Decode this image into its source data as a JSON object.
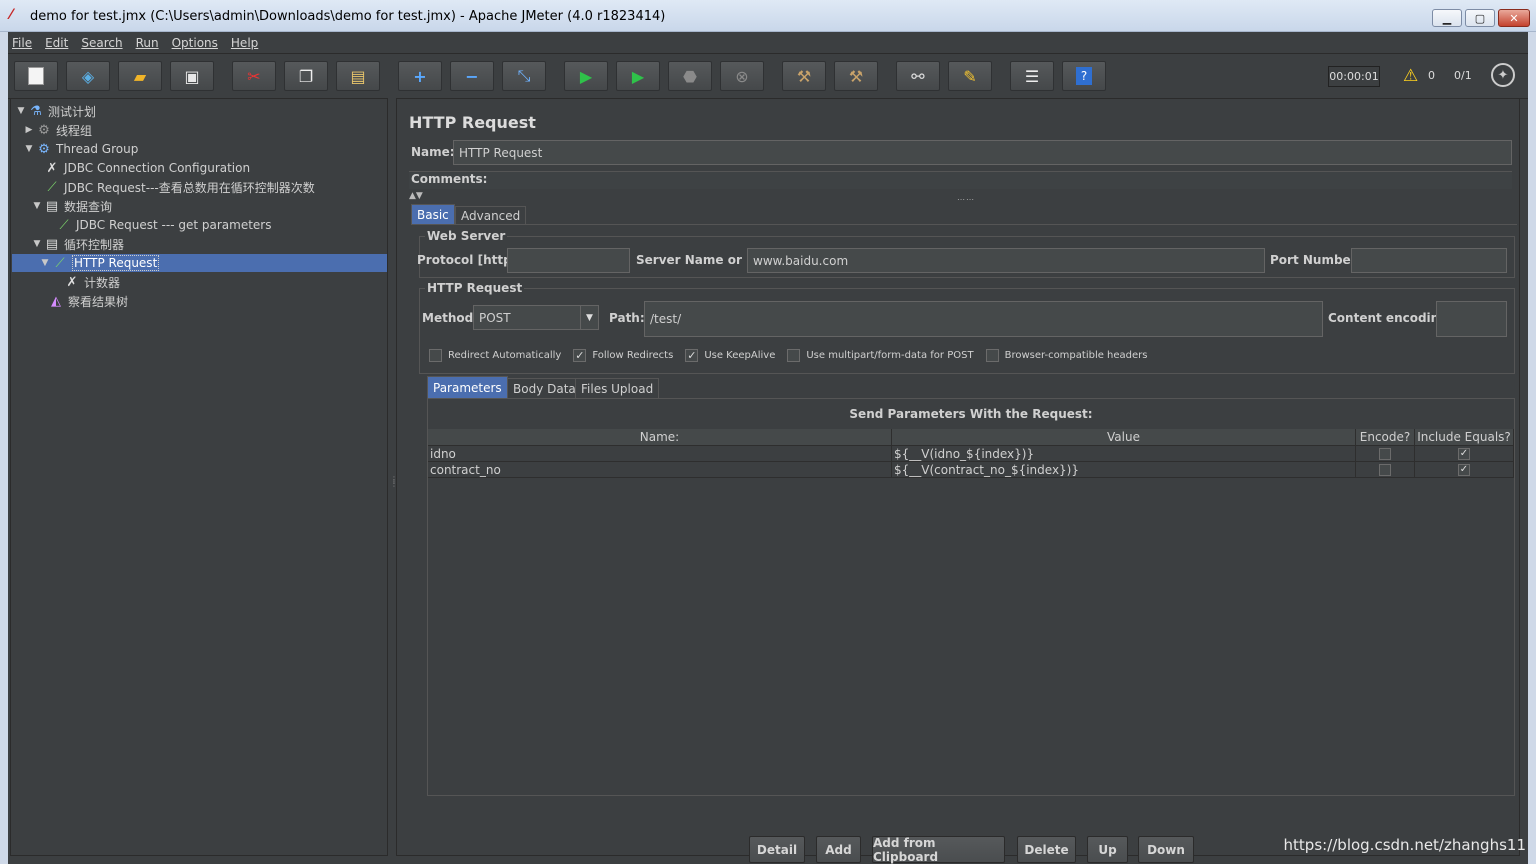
{
  "window": {
    "title": "demo for test.jmx (C:\\Users\\admin\\Downloads\\demo for test.jmx) - Apache JMeter (4.0 r1823414)",
    "buttons": {
      "minimize": "▁",
      "maximize": "▢",
      "close": "✕"
    }
  },
  "menu": [
    "File",
    "Edit",
    "Search",
    "Run",
    "Options",
    "Help"
  ],
  "toolbar": {
    "icons": [
      "new-icon",
      "templates-icon",
      "open-icon",
      "save-icon",
      "cut-icon",
      "copy-icon",
      "paste-icon",
      "expand-icon",
      "collapse-icon",
      "toggle-icon",
      "start-icon",
      "start-no-pause-icon",
      "stop-icon",
      "shutdown-icon",
      "clear-icon",
      "clear-all-icon",
      "search-icon",
      "reset-search-icon",
      "function-helper-icon",
      "help-icon"
    ],
    "timer": "00:00:01",
    "warning_count": "0",
    "threads": "0/1"
  },
  "tree": {
    "items": [
      {
        "label": "测试计划",
        "icon": "flask-icon"
      },
      {
        "label": "线程组",
        "icon": "gear-icon"
      },
      {
        "label": "Thread Group",
        "icon": "gear-icon"
      },
      {
        "label": "JDBC Connection Configuration",
        "icon": "wrench-icon"
      },
      {
        "label": "JDBC Request---查看总数用在循环控制器次数",
        "icon": "pipette-icon"
      },
      {
        "label": "数据查询",
        "icon": "controller-icon"
      },
      {
        "label": "JDBC Request --- get parameters",
        "icon": "pipette-icon"
      },
      {
        "label": "循环控制器",
        "icon": "controller-icon"
      },
      {
        "label": "HTTP Request",
        "icon": "pipette-icon"
      },
      {
        "label": "计数器",
        "icon": "wrench-icon"
      },
      {
        "label": "察看结果树",
        "icon": "chart-icon"
      }
    ]
  },
  "panel": {
    "title": "HTTP Request",
    "name_label": "Name:",
    "name_value": "HTTP Request",
    "comments_label": "Comments:",
    "tabs": [
      "Basic",
      "Advanced"
    ],
    "web_server": {
      "title": "Web Server",
      "protocol_label": "Protocol [http]:",
      "protocol_value": "",
      "server_label": "Server Name or IP:",
      "server_value": "www.baidu.com",
      "port_label": "Port Number:",
      "port_value": ""
    },
    "http_request": {
      "title": "HTTP Request",
      "method_label": "Method:",
      "method_value": "POST",
      "path_label": "Path:",
      "path_value": "/test/",
      "encoding_label": "Content encoding:",
      "encoding_value": ""
    },
    "checkboxes": [
      {
        "label": "Redirect Automatically",
        "checked": ""
      },
      {
        "label": "Follow Redirects",
        "checked": "✓"
      },
      {
        "label": "Use KeepAlive",
        "checked": "✓"
      },
      {
        "label": "Use multipart/form-data for POST",
        "checked": ""
      },
      {
        "label": "Browser-compatible headers",
        "checked": ""
      }
    ],
    "sub_tabs": [
      "Parameters",
      "Body Data",
      "Files Upload"
    ],
    "params_heading": "Send Parameters With the Request:",
    "columns": [
      "Name:",
      "Value",
      "Encode?",
      "Include Equals?"
    ],
    "rows": [
      {
        "name": "idno",
        "value": "${__V(idno_${index})}",
        "encode": "",
        "include": "✓"
      },
      {
        "name": "contract_no",
        "value": "${__V(contract_no_${index})}",
        "encode": "",
        "include": "✓"
      }
    ],
    "buttons": [
      "Detail",
      "Add",
      "Add from Clipboard",
      "Delete",
      "Up",
      "Down"
    ]
  },
  "watermark": "https://blog.csdn.net/zhanghs11"
}
